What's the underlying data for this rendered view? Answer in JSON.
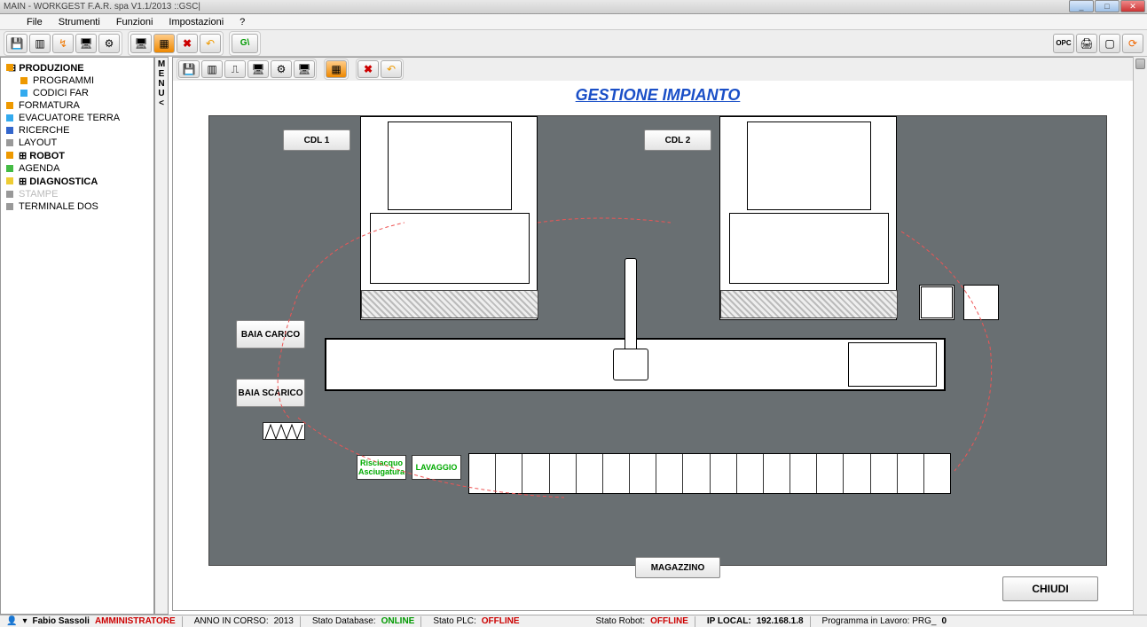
{
  "title": "MAIN - WORKGEST  F.A.R. spa  V1.1/2013      ::GSC|",
  "menu": {
    "file": "File",
    "strumenti": "Strumenti",
    "funzioni": "Funzioni",
    "impostazioni": "Impostazioni",
    "help": "?"
  },
  "side_toggle": "MENU<",
  "tree": {
    "produzione": "PRODUZIONE",
    "programmi": "PROGRAMMI",
    "codici": "CODICI FAR",
    "formatura": "FORMATURA",
    "evacuatore": "EVACUATORE TERRA",
    "ricerche": "RICERCHE",
    "layout": "LAYOUT",
    "robot": "ROBOT",
    "agenda": "AGENDA",
    "diagnostica": "DIAGNOSTICA",
    "stampe": "STAMPE",
    "terminale": "TERMINALE DOS"
  },
  "mimic": {
    "title": "GESTIONE IMPIANTO",
    "cdl1": "CDL 1",
    "cdl2": "CDL 2",
    "baia_carico": "BAIA CARICO",
    "baia_scarico": "BAIA SCARICO",
    "risciacquo": "Risciacquo Asciugatura",
    "lavaggio": "LAVAGGIO",
    "magazzino": "MAGAZZINO",
    "chiudi": "CHIUDI"
  },
  "status": {
    "user_icon": "▾",
    "user": "Fabio Sassoli",
    "role": "AMMINISTRATORE",
    "anno_label": "ANNO IN CORSO:",
    "anno": "2013",
    "db_label": "Stato Database:",
    "db": "ONLINE",
    "plc_label": "Stato PLC:",
    "plc": "OFFLINE",
    "robot_label": "Stato Robot:",
    "robot": "OFFLINE",
    "ip_label": "IP LOCAL:",
    "ip": "192.168.1.8",
    "prg_label": "Programma in Lavoro: PRG_",
    "prg": "0"
  }
}
